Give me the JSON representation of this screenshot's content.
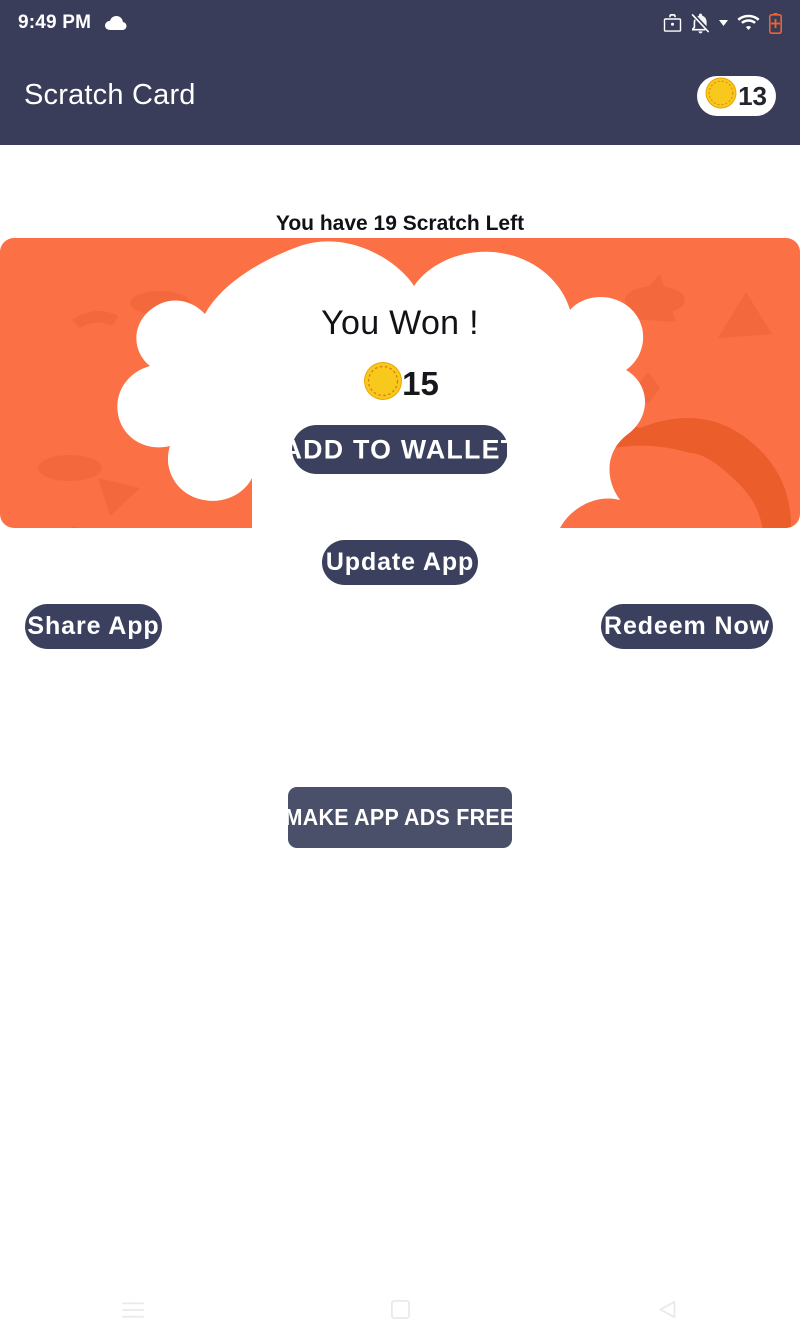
{
  "status_bar": {
    "time": "9:49 PM",
    "icons": [
      "cloud-icon",
      "work-profile-icon",
      "notifications-muted-icon",
      "signal-triangle-icon",
      "wifi-icon",
      "battery-icon"
    ],
    "battery_color": "#f2622d"
  },
  "app_bar": {
    "title": "Scratch Card",
    "coin_count": "13",
    "background": "#393d59",
    "coin_color": "#f7c51a"
  },
  "main": {
    "scratch_left_text": "You have 19 Scratch Left",
    "card": {
      "background": "#fb7045",
      "accent": "#e8562a",
      "won_title": "You Won !",
      "won_amount": "15",
      "add_to_wallet_label": "ADD TO WALLET"
    },
    "buttons": {
      "update_app": "Update App",
      "share_app": "Share App",
      "redeem_now": "Redeem Now",
      "make_app_ads_free": "MAKE APP ADS FREE"
    },
    "button_color": "#3b405e"
  },
  "nav_bar": {
    "recents_label": "recents-icon",
    "home_label": "home-icon",
    "back_label": "back-icon"
  }
}
